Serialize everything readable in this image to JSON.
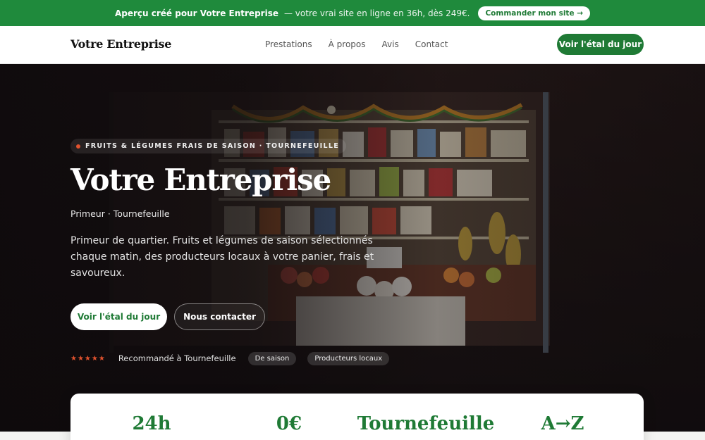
{
  "banner": {
    "strong": "Aperçu créé pour Votre Entreprise",
    "text": "— votre vrai site en ligne en 36h, dès 249€.",
    "cta": "Commander mon site →"
  },
  "nav": {
    "brand": "Votre Entreprise",
    "links": [
      "Prestations",
      "À propos",
      "Avis",
      "Contact"
    ],
    "cta": "Voir l'étal du jour"
  },
  "hero": {
    "kicker": "FRUITS & LÉGUMES FRAIS DE SAISON · TOURNEFEUILLE",
    "title": "Votre Entreprise",
    "subtitle": "Primeur · Tournefeuille",
    "description": "Primeur de quartier. Fruits et légumes de saison sélectionnés chaque matin, des producteurs locaux à votre panier, frais et savoureux.",
    "primary_button": "Voir l'étal du jour",
    "secondary_button": "Nous contacter",
    "stars": "★★★★★",
    "recommendation": "Recommandé à Tournefeuille",
    "tags": [
      "De saison",
      "Producteurs locaux"
    ]
  },
  "stats": [
    "24h",
    "0€",
    "Tournefeuille",
    "A→Z"
  ],
  "colors": {
    "brand_green": "#1f7a35",
    "banner_green": "#1f8a3c",
    "accent": "#e0522e"
  }
}
